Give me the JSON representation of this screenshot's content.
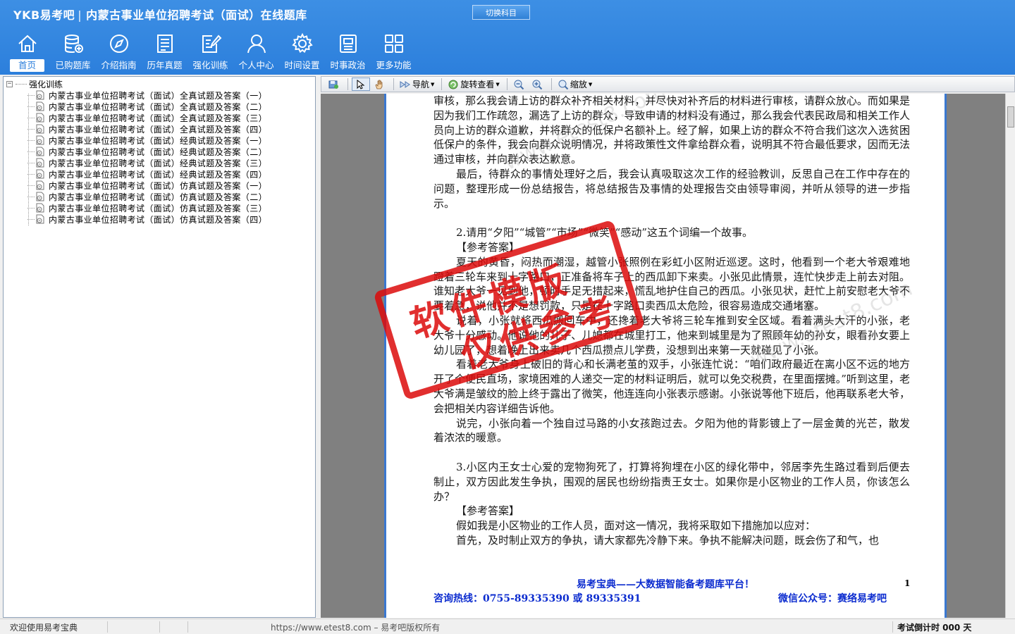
{
  "app": {
    "brand": "YKB易考吧",
    "title": "内蒙古事业单位招聘考试（面试）在线题库",
    "switch_subject": "切换科目"
  },
  "nav": [
    {
      "label": "首页",
      "icon": "home-icon",
      "active": true
    },
    {
      "label": "已购题库",
      "icon": "database-icon"
    },
    {
      "label": "介绍指南",
      "icon": "compass-icon"
    },
    {
      "label": "历年真题",
      "icon": "document-list-icon"
    },
    {
      "label": "强化训练",
      "icon": "edit-note-icon"
    },
    {
      "label": "个人中心",
      "icon": "user-icon"
    },
    {
      "label": "时间设置",
      "icon": "gear-icon"
    },
    {
      "label": "时事政治",
      "icon": "newspaper-icon"
    },
    {
      "label": "更多功能",
      "icon": "grid-icon"
    }
  ],
  "tree": {
    "expander": "−",
    "root": "强化训练",
    "items": [
      "内蒙古事业单位招聘考试（面试）全真试题及答案（一）",
      "内蒙古事业单位招聘考试（面试）全真试题及答案（二）",
      "内蒙古事业单位招聘考试（面试）全真试题及答案（三）",
      "内蒙古事业单位招聘考试（面试）全真试题及答案（四）",
      "内蒙古事业单位招聘考试（面试）经典试题及答案（一）",
      "内蒙古事业单位招聘考试（面试）经典试题及答案（二）",
      "内蒙古事业单位招聘考试（面试）经典试题及答案（三）",
      "内蒙古事业单位招聘考试（面试）经典试题及答案（四）",
      "内蒙古事业单位招聘考试（面试）仿真试题及答案（一）",
      "内蒙古事业单位招聘考试（面试）仿真试题及答案（二）",
      "内蒙古事业单位招聘考试（面试）仿真试题及答案（三）",
      "内蒙古事业单位招聘考试（面试）仿真试题及答案（四）"
    ]
  },
  "toolbar": {
    "navigate": "导航",
    "rotate_view": "旋转查看",
    "zoom": "缩放"
  },
  "document": {
    "paragraphs": [
      {
        "cls": "",
        "text": "审核，那么我会请上访的群众补齐相关材料，并尽快对补齐后的材料进行审核，请群众放心。而如果是因为我们工作疏忽，漏选了上访的群众，导致申请的材料没有通过，那么我会代表民政局和相关工作人员向上访的群众道歉，并将群众的低保户名额补上。经了解，如果上访的群众不符合我们这次入选贫困低保户的条件，我会向群众说明情况，并将政策性文件拿给群众看，说明其不符合最低要求，因而无法通过审核，并向群众表达歉意。"
      },
      {
        "cls": "indent",
        "text": "最后，待群众的事情处理好之后，我会认真吸取这次工作的经验教训，反思自己在工作中存在的问题，整理形成一份总结报告，将总结报告及事情的处理报告交由领导审阅，并听从领导的进一步指示。"
      },
      {
        "cls": "blank",
        "text": ""
      },
      {
        "cls": "indent",
        "text": "2.请用“夕阳”“城管”“市场”“微笑”“感动”这五个词编一个故事。"
      },
      {
        "cls": "indent",
        "text": "【参考答案】"
      },
      {
        "cls": "indent",
        "text": "夏天的黄昏，闷热而潮湿，越管小张照例在彩虹小区附近巡逻。这时，他看到一个老大爷艰难地蹬着三轮车来到十字路口，正准备将车子上的西瓜卸下来卖。小张见此情景，连忙快步走上前去对阻。谁知老大爷一见到他，顿时手足无措起来，慌乱地护住自己的西瓜。小张见状，赶忙上前安慰老大爷不要着急，说他并不是想罚款，只是在十字路口卖西瓜太危险，很容易造成交通堵塞。"
      },
      {
        "cls": "indent",
        "text": "说着，小张就将西瓜搬回车中，还搀着老大爷将三轮车推到安全区域。看着满头大汗的小张，老大爷十分感动。他说他的儿子、儿媳都在城里打工，他来到城里是为了照顾年幼的孙女，眼看孙女要上幼儿园了，想着晚上出来卖几个西瓜攒点儿学费，没想到出来第一天就碰见了小张。"
      },
      {
        "cls": "indent",
        "text": "看着老大爷身上破旧的背心和长满老茧的双手，小张连忙说：“咱们政府最近在离小区不远的地方开了个便民直场，家境困难的人递交一定的材料证明后，就可以免交税费，在里面摆摊。”听到这里，老大爷满是皱纹的脸上终于露出了微笑，他连连向小张表示感谢。小张说等他下班后，他再联系老大爷，会把相关内容详细告诉他。"
      },
      {
        "cls": "indent",
        "text": "说完，小张向着一个独自过马路的小女孩跑过去。夕阳为他的背影镀上了一层金黄的光芒，散发着浓浓的暖意。"
      },
      {
        "cls": "blank",
        "text": ""
      },
      {
        "cls": "indent",
        "text": "3.小区内王女士心爱的宠物狗死了，打算将狗埋在小区的绿化带中，邻居李先生路过看到后便去制止，双方因此发生争执，围观的居民也纷纷指责王女士。如果你是小区物业的工作人员，你该怎么办？"
      },
      {
        "cls": "indent",
        "text": "【参考答案】"
      },
      {
        "cls": "indent",
        "text": "假如我是小区物业的工作人员，面对这一情况，我将采取如下措施加以应对："
      },
      {
        "cls": "indent",
        "text": "首先，及时制止双方的争执，请大家都先冷静下来。争执不能解决问题，既会伤了和气，也"
      }
    ],
    "page_number": "1",
    "slogan": "易考宝典——大数据智能备考题库平台！",
    "hotline": "咨询热线：0755-89335390 或 89335391",
    "wechat": "微信公众号：赛络易考吧",
    "watermark": "www.etest8.com",
    "stamp_line1": "软件模版",
    "stamp_line2": "仅供参考"
  },
  "status": {
    "welcome": "欢迎使用易考宝典",
    "copyright": "https://www.etest8.com – 易考吧版权所有",
    "countdown": "考试倒计时 000 天"
  }
}
